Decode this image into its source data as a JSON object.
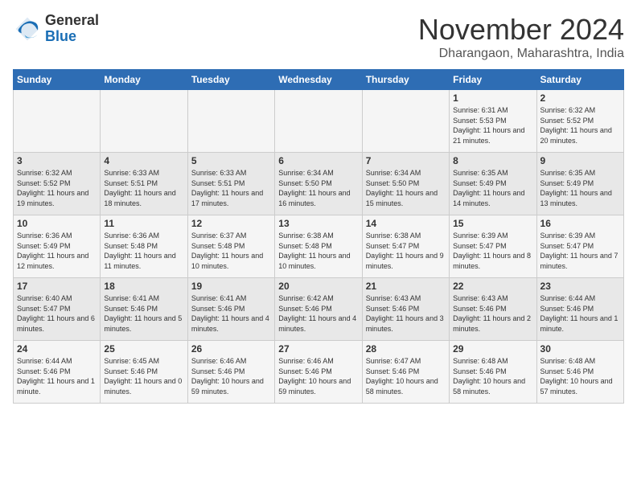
{
  "logo": {
    "general": "General",
    "blue": "Blue"
  },
  "header": {
    "month": "November 2024",
    "location": "Dharangaon, Maharashtra, India"
  },
  "days_of_week": [
    "Sunday",
    "Monday",
    "Tuesday",
    "Wednesday",
    "Thursday",
    "Friday",
    "Saturday"
  ],
  "weeks": [
    [
      {
        "day": "",
        "info": ""
      },
      {
        "day": "",
        "info": ""
      },
      {
        "day": "",
        "info": ""
      },
      {
        "day": "",
        "info": ""
      },
      {
        "day": "",
        "info": ""
      },
      {
        "day": "1",
        "info": "Sunrise: 6:31 AM\nSunset: 5:53 PM\nDaylight: 11 hours and 21 minutes."
      },
      {
        "day": "2",
        "info": "Sunrise: 6:32 AM\nSunset: 5:52 PM\nDaylight: 11 hours and 20 minutes."
      }
    ],
    [
      {
        "day": "3",
        "info": "Sunrise: 6:32 AM\nSunset: 5:52 PM\nDaylight: 11 hours and 19 minutes."
      },
      {
        "day": "4",
        "info": "Sunrise: 6:33 AM\nSunset: 5:51 PM\nDaylight: 11 hours and 18 minutes."
      },
      {
        "day": "5",
        "info": "Sunrise: 6:33 AM\nSunset: 5:51 PM\nDaylight: 11 hours and 17 minutes."
      },
      {
        "day": "6",
        "info": "Sunrise: 6:34 AM\nSunset: 5:50 PM\nDaylight: 11 hours and 16 minutes."
      },
      {
        "day": "7",
        "info": "Sunrise: 6:34 AM\nSunset: 5:50 PM\nDaylight: 11 hours and 15 minutes."
      },
      {
        "day": "8",
        "info": "Sunrise: 6:35 AM\nSunset: 5:49 PM\nDaylight: 11 hours and 14 minutes."
      },
      {
        "day": "9",
        "info": "Sunrise: 6:35 AM\nSunset: 5:49 PM\nDaylight: 11 hours and 13 minutes."
      }
    ],
    [
      {
        "day": "10",
        "info": "Sunrise: 6:36 AM\nSunset: 5:49 PM\nDaylight: 11 hours and 12 minutes."
      },
      {
        "day": "11",
        "info": "Sunrise: 6:36 AM\nSunset: 5:48 PM\nDaylight: 11 hours and 11 minutes."
      },
      {
        "day": "12",
        "info": "Sunrise: 6:37 AM\nSunset: 5:48 PM\nDaylight: 11 hours and 10 minutes."
      },
      {
        "day": "13",
        "info": "Sunrise: 6:38 AM\nSunset: 5:48 PM\nDaylight: 11 hours and 10 minutes."
      },
      {
        "day": "14",
        "info": "Sunrise: 6:38 AM\nSunset: 5:47 PM\nDaylight: 11 hours and 9 minutes."
      },
      {
        "day": "15",
        "info": "Sunrise: 6:39 AM\nSunset: 5:47 PM\nDaylight: 11 hours and 8 minutes."
      },
      {
        "day": "16",
        "info": "Sunrise: 6:39 AM\nSunset: 5:47 PM\nDaylight: 11 hours and 7 minutes."
      }
    ],
    [
      {
        "day": "17",
        "info": "Sunrise: 6:40 AM\nSunset: 5:47 PM\nDaylight: 11 hours and 6 minutes."
      },
      {
        "day": "18",
        "info": "Sunrise: 6:41 AM\nSunset: 5:46 PM\nDaylight: 11 hours and 5 minutes."
      },
      {
        "day": "19",
        "info": "Sunrise: 6:41 AM\nSunset: 5:46 PM\nDaylight: 11 hours and 4 minutes."
      },
      {
        "day": "20",
        "info": "Sunrise: 6:42 AM\nSunset: 5:46 PM\nDaylight: 11 hours and 4 minutes."
      },
      {
        "day": "21",
        "info": "Sunrise: 6:43 AM\nSunset: 5:46 PM\nDaylight: 11 hours and 3 minutes."
      },
      {
        "day": "22",
        "info": "Sunrise: 6:43 AM\nSunset: 5:46 PM\nDaylight: 11 hours and 2 minutes."
      },
      {
        "day": "23",
        "info": "Sunrise: 6:44 AM\nSunset: 5:46 PM\nDaylight: 11 hours and 1 minute."
      }
    ],
    [
      {
        "day": "24",
        "info": "Sunrise: 6:44 AM\nSunset: 5:46 PM\nDaylight: 11 hours and 1 minute."
      },
      {
        "day": "25",
        "info": "Sunrise: 6:45 AM\nSunset: 5:46 PM\nDaylight: 11 hours and 0 minutes."
      },
      {
        "day": "26",
        "info": "Sunrise: 6:46 AM\nSunset: 5:46 PM\nDaylight: 10 hours and 59 minutes."
      },
      {
        "day": "27",
        "info": "Sunrise: 6:46 AM\nSunset: 5:46 PM\nDaylight: 10 hours and 59 minutes."
      },
      {
        "day": "28",
        "info": "Sunrise: 6:47 AM\nSunset: 5:46 PM\nDaylight: 10 hours and 58 minutes."
      },
      {
        "day": "29",
        "info": "Sunrise: 6:48 AM\nSunset: 5:46 PM\nDaylight: 10 hours and 58 minutes."
      },
      {
        "day": "30",
        "info": "Sunrise: 6:48 AM\nSunset: 5:46 PM\nDaylight: 10 hours and 57 minutes."
      }
    ]
  ]
}
